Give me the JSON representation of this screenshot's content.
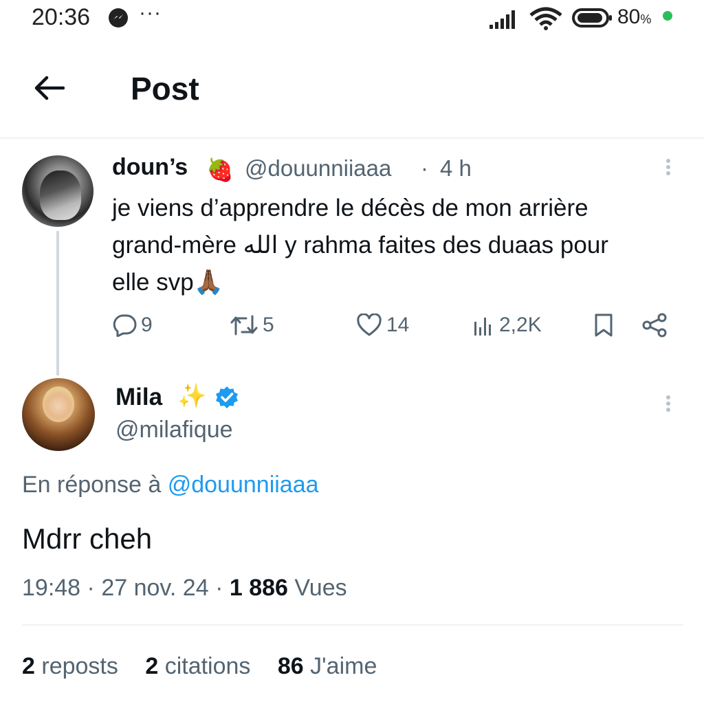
{
  "status_bar": {
    "time": "20:36",
    "dots": "···",
    "battery": "80",
    "battery_unit": "%",
    "battery_dot_color": "#2bbf5b"
  },
  "header": {
    "title": "Post",
    "back_icon": "arrow-left-icon"
  },
  "parent_tweet": {
    "display_name": "doun’s",
    "name_emoji": "🍓",
    "handle": "@douunniiaaa",
    "separator": "·",
    "time": "4 h",
    "text_line1": "je viens d’apprendre le décès de mon arrière",
    "text_line2": "grand-mère الله y rahma faites des duaas pour",
    "text_line3": "elle svp🙏🏾",
    "replies": "9",
    "reposts": "5",
    "likes": "14",
    "views": "2,2K"
  },
  "reply_tweet": {
    "display_name": "Mila",
    "name_emoji": "✨",
    "verified_color": "#1d9bf0",
    "handle": "@milafique",
    "reply_to_prefix": "En réponse à",
    "reply_to_handle": "@douunniiaaa",
    "text": "Mdrr cheh",
    "time": "19:48",
    "date": "27 nov. 24",
    "separator": "·",
    "views_count": "1 886",
    "views_label": "Vues"
  },
  "stats": {
    "reposts_count": "2",
    "reposts_label": "reposts",
    "quotes_count": "2",
    "quotes_label": "citations",
    "likes_count": "86",
    "likes_label": "J'aime"
  },
  "colors": {
    "text_primary": "#0f1419",
    "text_secondary": "#536471",
    "link": "#1d9bf0",
    "divider": "#eff3f4"
  }
}
